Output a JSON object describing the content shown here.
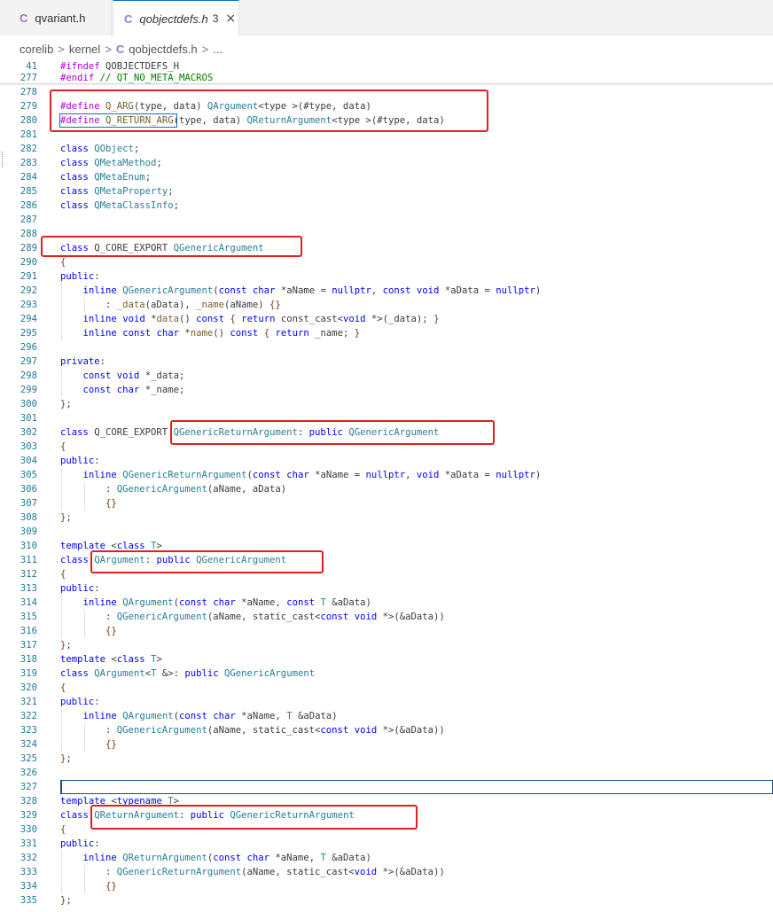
{
  "tabs": [
    {
      "icon": "C",
      "label": "qvariant.h"
    },
    {
      "icon": "C",
      "label": "qobjectdefs.h",
      "count": "3",
      "close": "×"
    }
  ],
  "breadcrumb": {
    "items": [
      "corelib",
      "kernel",
      "qobjectdefs.h",
      "..."
    ],
    "sep": ">",
    "file_icon": "C"
  },
  "sticky_lines": [
    {
      "n": "41",
      "code": "#ifndef QOBJECTDEFS_H"
    },
    {
      "n": "277",
      "code": "#endif // QT_NO_META_MACROS"
    }
  ],
  "lines": [
    {
      "n": "278",
      "code": ""
    },
    {
      "n": "279",
      "code": "#define Q_ARG(type, data) QArgument<type >(#type, data)"
    },
    {
      "n": "280",
      "code": "#define Q_RETURN_ARG(type, data) QReturnArgument<type >(#type, data)"
    },
    {
      "n": "281",
      "code": ""
    },
    {
      "n": "282",
      "code": "class QObject;"
    },
    {
      "n": "283",
      "code": "class QMetaMethod;"
    },
    {
      "n": "284",
      "code": "class QMetaEnum;"
    },
    {
      "n": "285",
      "code": "class QMetaProperty;"
    },
    {
      "n": "286",
      "code": "class QMetaClassInfo;"
    },
    {
      "n": "287",
      "code": ""
    },
    {
      "n": "288",
      "code": ""
    },
    {
      "n": "289",
      "code": "class Q_CORE_EXPORT QGenericArgument"
    },
    {
      "n": "290",
      "code": "{"
    },
    {
      "n": "291",
      "code": "public:"
    },
    {
      "n": "292",
      "code": "    inline QGenericArgument(const char *aName = nullptr, const void *aData = nullptr)"
    },
    {
      "n": "293",
      "code": "        : _data(aData), _name(aName) {}"
    },
    {
      "n": "294",
      "code": "    inline void *data() const { return const_cast<void *>(_data); }"
    },
    {
      "n": "295",
      "code": "    inline const char *name() const { return _name; }"
    },
    {
      "n": "296",
      "code": ""
    },
    {
      "n": "297",
      "code": "private:"
    },
    {
      "n": "298",
      "code": "    const void *_data;"
    },
    {
      "n": "299",
      "code": "    const char *_name;"
    },
    {
      "n": "300",
      "code": "};"
    },
    {
      "n": "301",
      "code": ""
    },
    {
      "n": "302",
      "code": "class Q_CORE_EXPORT QGenericReturnArgument: public QGenericArgument"
    },
    {
      "n": "303",
      "code": "{"
    },
    {
      "n": "304",
      "code": "public:"
    },
    {
      "n": "305",
      "code": "    inline QGenericReturnArgument(const char *aName = nullptr, void *aData = nullptr)"
    },
    {
      "n": "306",
      "code": "        : QGenericArgument(aName, aData)"
    },
    {
      "n": "307",
      "code": "        {}"
    },
    {
      "n": "308",
      "code": "};"
    },
    {
      "n": "309",
      "code": ""
    },
    {
      "n": "310",
      "code": "template <class T>"
    },
    {
      "n": "311",
      "code": "class QArgument: public QGenericArgument"
    },
    {
      "n": "312",
      "code": "{"
    },
    {
      "n": "313",
      "code": "public:"
    },
    {
      "n": "314",
      "code": "    inline QArgument(const char *aName, const T &aData)"
    },
    {
      "n": "315",
      "code": "        : QGenericArgument(aName, static_cast<const void *>(&aData))"
    },
    {
      "n": "316",
      "code": "        {}"
    },
    {
      "n": "317",
      "code": "};"
    },
    {
      "n": "318",
      "code": "template <class T>"
    },
    {
      "n": "319",
      "code": "class QArgument<T &>: public QGenericArgument"
    },
    {
      "n": "320",
      "code": "{"
    },
    {
      "n": "321",
      "code": "public:"
    },
    {
      "n": "322",
      "code": "    inline QArgument(const char *aName, T &aData)"
    },
    {
      "n": "323",
      "code": "        : QGenericArgument(aName, static_cast<const void *>(&aData))"
    },
    {
      "n": "324",
      "code": "        {}"
    },
    {
      "n": "325",
      "code": "};"
    },
    {
      "n": "326",
      "code": ""
    },
    {
      "n": "327",
      "code": ""
    },
    {
      "n": "328",
      "code": "template <typename T>"
    },
    {
      "n": "329",
      "code": "class QReturnArgument: public QGenericReturnArgument"
    },
    {
      "n": "330",
      "code": "{"
    },
    {
      "n": "331",
      "code": "public:"
    },
    {
      "n": "332",
      "code": "    inline QReturnArgument(const char *aName, T &aData)"
    },
    {
      "n": "333",
      "code": "        : QGenericReturnArgument(aName, static_cast<void *>(&aData))"
    },
    {
      "n": "334",
      "code": "        {}"
    },
    {
      "n": "335",
      "code": "};"
    }
  ]
}
